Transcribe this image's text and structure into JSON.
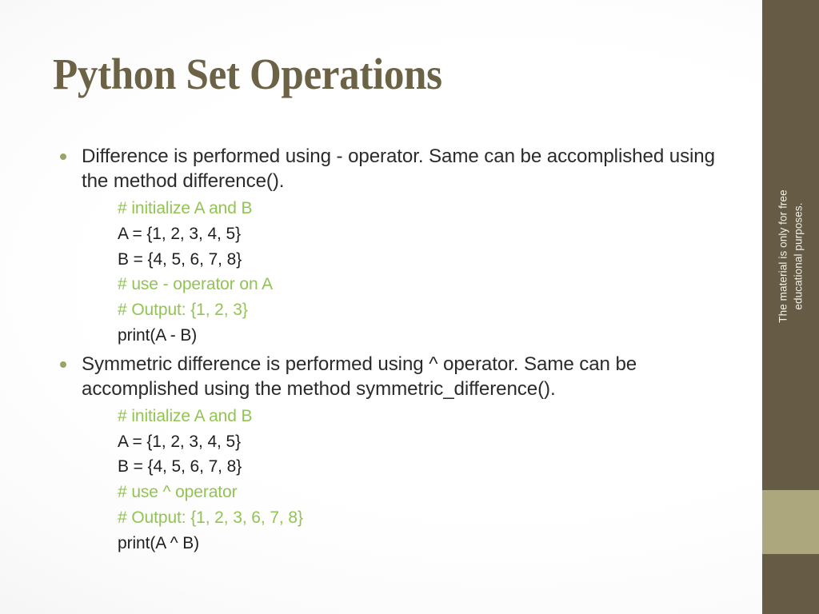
{
  "slide": {
    "title": "Python Set Operations",
    "sidebar_note": "The material is only for free educational purposes.",
    "colors": {
      "title": "#6c6347",
      "sidebar": "#665c45",
      "sidebar_band": "#aca77c",
      "bullet_marker": "#9aa368",
      "comment_green": "#92c353",
      "code_text": "#1f1f1f",
      "body_text": "#2b2b2b",
      "background": "#ffffff"
    },
    "sections": [
      {
        "bullet": "Difference is performed using - operator. Same can be accomplished using the method difference().",
        "code": [
          {
            "text": "# initialize A and B",
            "kind": "comment"
          },
          {
            "text": "A = {1, 2, 3, 4, 5}",
            "kind": "code"
          },
          {
            "text": "B = {4, 5, 6, 7, 8}",
            "kind": "code"
          },
          {
            "text": "# use - operator on A",
            "kind": "comment"
          },
          {
            "text": "# Output: {1, 2, 3}",
            "kind": "comment"
          },
          {
            "text": "print(A - B)",
            "kind": "code"
          }
        ]
      },
      {
        "bullet": "Symmetric difference is performed using ^ operator. Same can be accomplished using the method symmetric_difference().",
        "code": [
          {
            "text": "# initialize A and B",
            "kind": "comment"
          },
          {
            "text": "A = {1, 2, 3, 4, 5}",
            "kind": "code"
          },
          {
            "text": "B = {4, 5, 6, 7, 8}",
            "kind": "code"
          },
          {
            "text": "# use ^ operator",
            "kind": "comment"
          },
          {
            "text": "# Output: {1, 2, 3, 6, 7, 8}",
            "kind": "comment"
          },
          {
            "text": "print(A ^ B)",
            "kind": "code"
          }
        ]
      }
    ]
  }
}
